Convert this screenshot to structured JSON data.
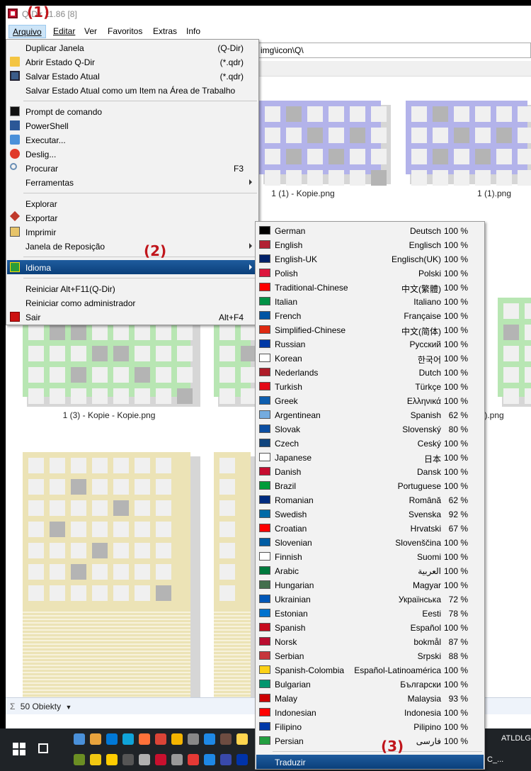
{
  "window": {
    "title": "Q-Dir 11.86 [8]",
    "address": "img\\icon\\Q\\"
  },
  "menubar": [
    {
      "label": "Arquivo",
      "active": true
    },
    {
      "label": "Editar",
      "active": false
    },
    {
      "label": "Ver",
      "active": false
    },
    {
      "label": "Favoritos",
      "active": false
    },
    {
      "label": "Extras",
      "active": false
    },
    {
      "label": "Info",
      "active": false
    }
  ],
  "file_menu": {
    "items": [
      {
        "label": "Duplicar Janela",
        "shortcut": "(Q-Dir)",
        "icon": ""
      },
      {
        "label": "Abrir Estado Q-Dir",
        "shortcut": "(*.qdr)",
        "icon": "folder-icon"
      },
      {
        "label": "Salvar Estado Atual",
        "shortcut": "(*.qdr)",
        "icon": "save-icon"
      },
      {
        "label": "Salvar Estado Atual como um Item na Área de Trabalho",
        "shortcut": "",
        "icon": ""
      },
      {
        "label": "Prompt de comando",
        "shortcut": "",
        "icon": "cmd-icon"
      },
      {
        "label": "PowerShell",
        "shortcut": "",
        "icon": "powershell-icon"
      },
      {
        "label": "Executar...",
        "shortcut": "",
        "icon": "run-icon"
      },
      {
        "label": "Deslig...",
        "shortcut": "",
        "icon": "power-icon"
      },
      {
        "label": "Procurar",
        "shortcut": "F3",
        "icon": "search-icon"
      },
      {
        "label": "Ferramentas",
        "shortcut": "",
        "icon": "",
        "submenu": true
      },
      {
        "label": "Explorar",
        "shortcut": "",
        "icon": ""
      },
      {
        "label": "Exportar",
        "shortcut": "",
        "icon": "export-icon"
      },
      {
        "label": "Imprimir",
        "shortcut": "",
        "icon": "printer-icon"
      },
      {
        "label": "Janela de Reposição",
        "shortcut": "",
        "icon": "",
        "submenu": true
      },
      {
        "label": "Idioma",
        "shortcut": "",
        "icon": "flag-icon",
        "submenu": true,
        "highlighted": true
      },
      {
        "label": "Reiniciar Alt+F11(Q-Dir)",
        "shortcut": "",
        "icon": ""
      },
      {
        "label": "Reiniciar como administrador",
        "shortcut": "",
        "icon": ""
      },
      {
        "label": "Sair",
        "shortcut": "Alt+F4",
        "icon": "exit-icon"
      }
    ]
  },
  "languages": [
    {
      "name": "German",
      "native": "Deutsch",
      "pct": "100 %"
    },
    {
      "name": "English",
      "native": "Englisch",
      "pct": "100 %"
    },
    {
      "name": "English-UK",
      "native": "Englisch(UK)",
      "pct": "100 %"
    },
    {
      "name": "Polish",
      "native": "Polski",
      "pct": "100 %"
    },
    {
      "name": "Traditional-Chinese",
      "native": "中文(繁體)",
      "pct": "100 %"
    },
    {
      "name": "Italian",
      "native": "Italiano",
      "pct": "100 %"
    },
    {
      "name": "French",
      "native": "Française",
      "pct": "100 %"
    },
    {
      "name": "Simplified-Chinese",
      "native": "中文(简体)",
      "pct": "100 %"
    },
    {
      "name": "Russian",
      "native": "Русский",
      "pct": "100 %"
    },
    {
      "name": "Korean",
      "native": "한국어",
      "pct": "100 %"
    },
    {
      "name": "Nederlands",
      "native": "Dutch",
      "pct": "100 %"
    },
    {
      "name": "Turkish",
      "native": "Türkçe",
      "pct": "100 %"
    },
    {
      "name": "Greek",
      "native": "Ελληνικά",
      "pct": "100 %"
    },
    {
      "name": "Argentinean",
      "native": "Spanish",
      "pct": "62 %"
    },
    {
      "name": "Slovak",
      "native": "Slovenský",
      "pct": "80 %"
    },
    {
      "name": "Czech",
      "native": "Ceský",
      "pct": "100 %"
    },
    {
      "name": "Japanese",
      "native": "日本",
      "pct": "100 %"
    },
    {
      "name": "Danish",
      "native": "Dansk",
      "pct": "100 %"
    },
    {
      "name": "Brazil",
      "native": "Portuguese",
      "pct": "100 %"
    },
    {
      "name": "Romanian",
      "native": "Română",
      "pct": "62 %"
    },
    {
      "name": "Swedish",
      "native": "Svenska",
      "pct": "92 %"
    },
    {
      "name": "Croatian",
      "native": "Hrvatski",
      "pct": "67 %"
    },
    {
      "name": "Slovenian",
      "native": "Slovenščina",
      "pct": "100 %"
    },
    {
      "name": "Finnish",
      "native": "Suomi",
      "pct": "100 %"
    },
    {
      "name": "Arabic",
      "native": "العربية",
      "pct": "100 %"
    },
    {
      "name": "Hungarian",
      "native": "Magyar",
      "pct": "100 %"
    },
    {
      "name": "Ukrainian",
      "native": "Українська",
      "pct": "72 %"
    },
    {
      "name": "Estonian",
      "native": "Eesti",
      "pct": "78 %"
    },
    {
      "name": "Spanish",
      "native": "Español",
      "pct": "100 %"
    },
    {
      "name": "Norsk",
      "native": "bokmål",
      "pct": "87 %"
    },
    {
      "name": "Serbian",
      "native": "Srpski",
      "pct": "88 %"
    },
    {
      "name": "Spanish-Colombia",
      "native": "Español-Latinoamérica",
      "pct": "100 %"
    },
    {
      "name": "Bulgarian",
      "native": "Български",
      "pct": "100 %"
    },
    {
      "name": "Malay",
      "native": "Malaysia",
      "pct": "93 %"
    },
    {
      "name": "Indonesian",
      "native": "Indonesia",
      "pct": "100 %"
    },
    {
      "name": "Filipino",
      "native": "Pilipino",
      "pct": "100 %"
    },
    {
      "name": "Persian",
      "native": "فارسی",
      "pct": "100 %"
    }
  ],
  "translate_item": "Traduzir",
  "files": [
    {
      "name": "1 (1) - Kopie.png",
      "color": "#b3b3ea"
    },
    {
      "name": "1 (1).png",
      "color": "#b3b3ea"
    },
    {
      "name": "1 (3) - Kopie - Kopie.png",
      "color": "#b8e6b3"
    },
    {
      "name": ").png",
      "color": "#b8e6b3"
    }
  ],
  "status": {
    "text": "50 Obiekty"
  },
  "annotations": [
    "(1)",
    "(2)",
    "(3)"
  ],
  "taskbar": {
    "app1": "ATLDLG",
    "app2": "C_..."
  },
  "colors": {
    "highlight": "#0a3f7a",
    "annotation": "#c0161c",
    "purple": "#b3b3ea",
    "green": "#b8e6b3",
    "yellow": "#ece3b6"
  }
}
